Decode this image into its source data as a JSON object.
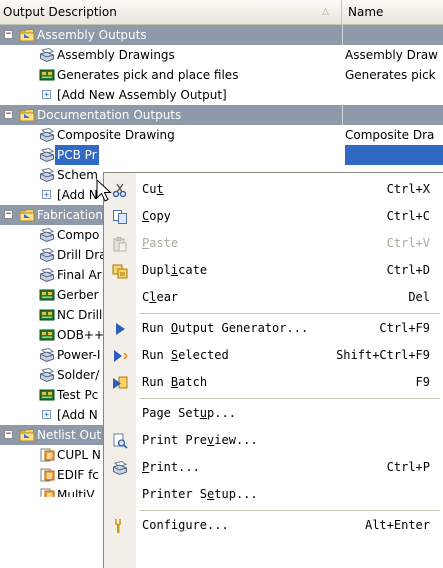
{
  "header": {
    "col_description": "Output Description",
    "col_name": "Name"
  },
  "tree": {
    "assembly": {
      "label": "Assembly Outputs",
      "items": [
        {
          "desc": "Assembly Drawings",
          "name": "Assembly Draw",
          "icon": "printer-icon"
        },
        {
          "desc": "Generates pick and place files",
          "name": "Generates pick",
          "icon": "board-file-icon"
        }
      ],
      "add": "[Add New Assembly Output]"
    },
    "documentation": {
      "label": "Documentation Outputs",
      "items": [
        {
          "desc": "Composite Drawing",
          "name": "Composite Dra",
          "icon": "printer-icon"
        },
        {
          "desc": "PCB Pr",
          "name": "",
          "icon": "printer-icon",
          "selected": true
        },
        {
          "desc": "Schem",
          "name": "",
          "icon": "printer-icon"
        }
      ],
      "add": "[Add N"
    },
    "fabrication": {
      "label": "Fabrication",
      "items": [
        {
          "desc": "Compo",
          "icon": "printer-icon"
        },
        {
          "desc": "Drill Dra",
          "icon": "printer-icon"
        },
        {
          "desc": "Final Ar",
          "icon": "printer-icon"
        },
        {
          "desc": "Gerber",
          "icon": "board-file-icon"
        },
        {
          "desc": "NC Drill",
          "icon": "board-file-icon"
        },
        {
          "desc": "ODB++",
          "icon": "board-file-icon"
        },
        {
          "desc": "Power-I",
          "icon": "printer-icon"
        },
        {
          "desc": "Solder/",
          "icon": "printer-icon"
        },
        {
          "desc": "Test Pc",
          "icon": "board-file-icon"
        }
      ],
      "add": "[Add N"
    },
    "netlist": {
      "label": "Netlist Out",
      "items": [
        {
          "desc": "CUPL N",
          "icon": "document-icon"
        },
        {
          "desc": "EDIF fc",
          "icon": "document-icon"
        },
        {
          "desc": "MultiV",
          "icon": "document-icon"
        }
      ]
    }
  },
  "context_menu": {
    "items": [
      {
        "pre": "Cu",
        "ul": "t",
        "post": "",
        "shortcut": "Ctrl+X"
      },
      {
        "pre": "",
        "ul": "C",
        "post": "opy",
        "shortcut": "Ctrl+C"
      },
      {
        "pre": "",
        "ul": "P",
        "post": "aste",
        "shortcut": "Ctrl+V",
        "disabled": true
      },
      {
        "pre": "Dupl",
        "ul": "i",
        "post": "cate",
        "shortcut": "Ctrl+D"
      },
      {
        "pre": "C",
        "ul": "l",
        "post": "ear",
        "shortcut": "Del"
      },
      {
        "pre": "Run ",
        "ul": "O",
        "post": "utput Generator...",
        "shortcut": "Ctrl+F9"
      },
      {
        "pre": "Run ",
        "ul": "S",
        "post": "elected",
        "shortcut": "Shift+Ctrl+F9"
      },
      {
        "pre": "Run ",
        "ul": "B",
        "post": "atch",
        "shortcut": "F9"
      },
      {
        "pre": "Page Set",
        "ul": "u",
        "post": "p...",
        "shortcut": ""
      },
      {
        "pre": "Print Pre",
        "ul": "v",
        "post": "iew...",
        "shortcut": ""
      },
      {
        "pre": "",
        "ul": "P",
        "post": "rint...",
        "shortcut": "Ctrl+P"
      },
      {
        "pre": "Printer S",
        "ul": "e",
        "post": "tup...",
        "shortcut": ""
      },
      {
        "pre": "Confi",
        "ul": "g",
        "post": "ure...",
        "shortcut": "Alt+Enter"
      }
    ]
  },
  "colors": {
    "group_row": "#8e99a9",
    "selection": "#316ac5",
    "menu_gutter": "#f1efe7"
  }
}
